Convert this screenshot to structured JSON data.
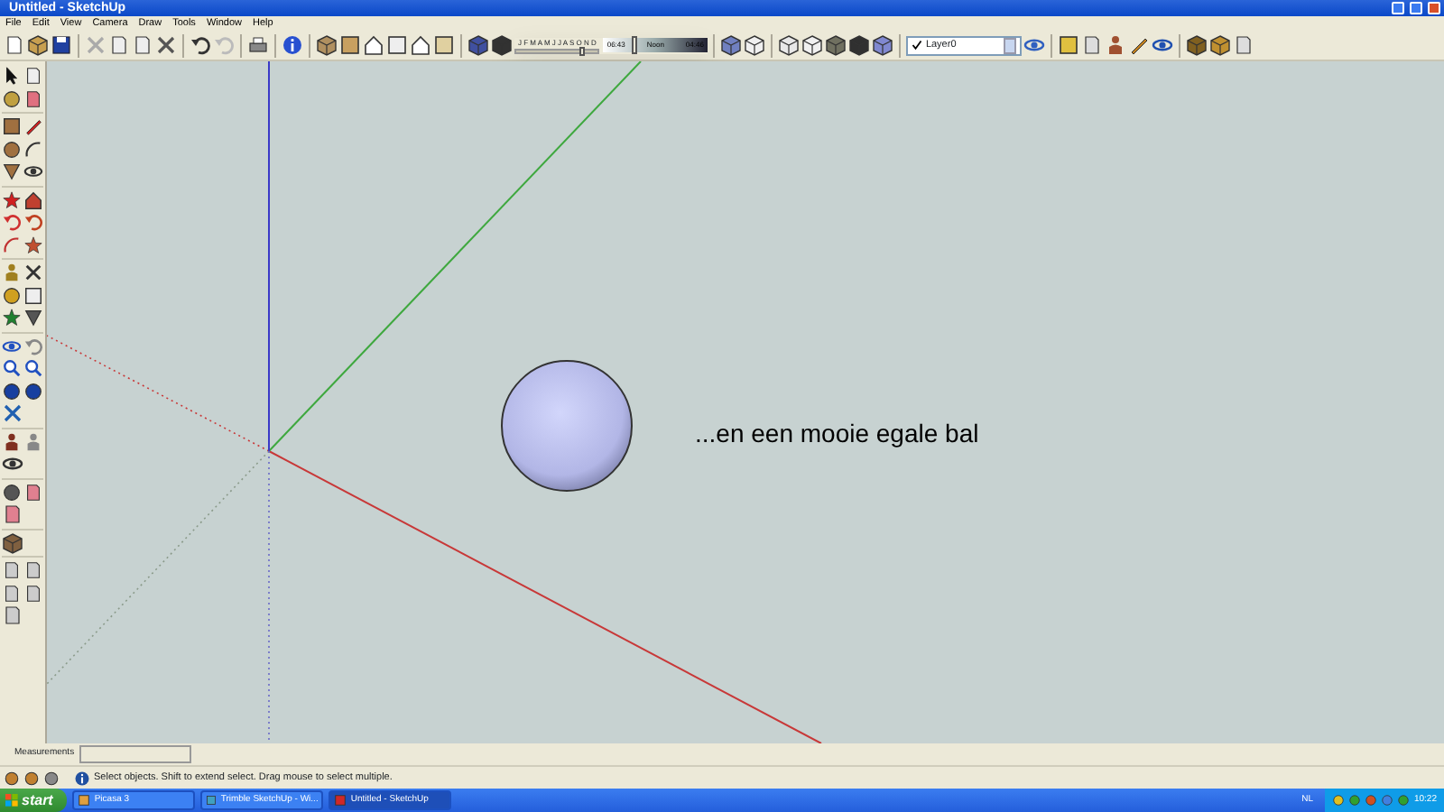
{
  "window": {
    "title": "Untitled - SketchUp"
  },
  "menu": [
    {
      "label": "File"
    },
    {
      "label": "Edit"
    },
    {
      "label": "View"
    },
    {
      "label": "Camera"
    },
    {
      "label": "Draw"
    },
    {
      "label": "Tools"
    },
    {
      "label": "Window"
    },
    {
      "label": "Help"
    }
  ],
  "shadow_toolbar": {
    "months": "J F M A M J J A S O N D",
    "time_start": "06:43",
    "time_middle": "Noon",
    "time_end": "04:46",
    "month_slider": {
      "level": 0.8
    },
    "time_slider": {
      "level": 0.3
    }
  },
  "layer_dropdown": {
    "value": "Layer0",
    "checked": true
  },
  "canvas": {
    "caption": "...en een mooie egale bal"
  },
  "measurements": {
    "label": "Measurements"
  },
  "status_bar": {
    "text": "Select objects. Shift to extend select. Drag mouse to select multiple."
  },
  "taskbar": {
    "start": "start",
    "items": [
      {
        "label": "Picasa 3",
        "selected": false
      },
      {
        "label": "Trimble SketchUp - Wi...",
        "selected": false
      },
      {
        "label": "Untitled - SketchUp",
        "selected": true
      }
    ],
    "language": "NL",
    "clock": "10:22"
  }
}
